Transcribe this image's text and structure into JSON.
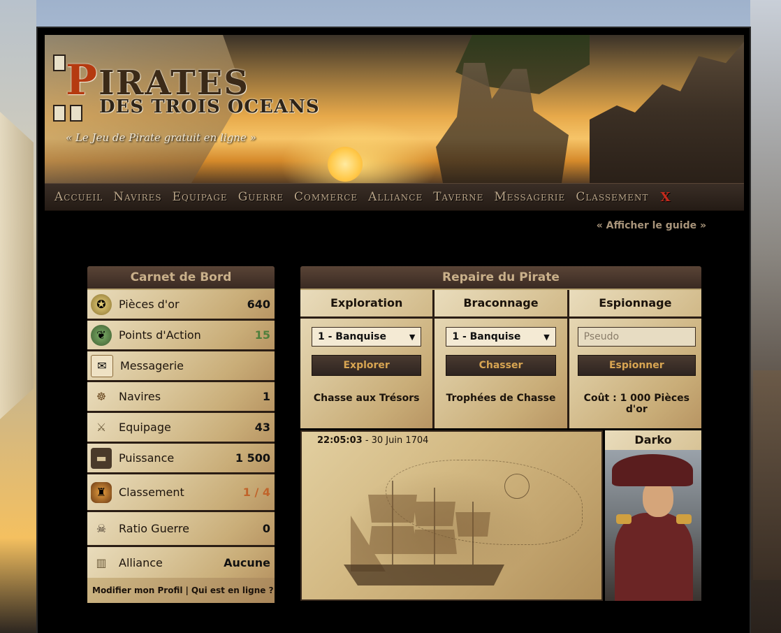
{
  "logo": {
    "line1_cap": "P",
    "line1_rest": "IRATES",
    "line2": "DES TROIS OCEANS",
    "tagline": "« Le Jeu de Pirate gratuit en ligne »"
  },
  "nav": {
    "items": [
      "Accueil",
      "Navires",
      "Equipage",
      "Guerre",
      "Commerce",
      "Alliance",
      "Taverne",
      "Messagerie",
      "Classement"
    ],
    "close": "X"
  },
  "guide_link": "« Afficher le guide »",
  "logbook": {
    "title": "Carnet de Bord",
    "rows": [
      {
        "label": "Pièces d'or",
        "value": "640",
        "icon": "gold-coin-icon"
      },
      {
        "label": "Points d'Action",
        "value": "15",
        "icon": "parrot-icon",
        "value_color": "#4f7f3c"
      },
      {
        "label": "Messagerie",
        "value": "",
        "icon": "envelope-icon"
      },
      {
        "label": "Navires",
        "value": "1",
        "icon": "ship-wheel-icon"
      },
      {
        "label": "Equipage",
        "value": "43",
        "icon": "crossed-swords-icon"
      },
      {
        "label": "Puissance",
        "value": "1 500",
        "icon": "cannon-icon"
      },
      {
        "label": "Classement",
        "value": "1 / 4",
        "icon": "lantern-icon",
        "value_color": "#c0632a"
      },
      {
        "label": "Ratio Guerre",
        "value": "0",
        "icon": "skull-crossbones-icon"
      },
      {
        "label": "Alliance",
        "value": "Aucune",
        "icon": "fortress-icon"
      }
    ],
    "footer_profile": "Modifier mon Profil",
    "footer_sep": "|",
    "footer_online": "Qui est en ligne ?"
  },
  "lair": {
    "title": "Repaire du Pirate",
    "exploration": {
      "title": "Exploration",
      "select": "1 - Banquise",
      "button": "Explorer",
      "link": "Chasse aux Trésors"
    },
    "poaching": {
      "title": "Braconnage",
      "select": "1 - Banquise",
      "button": "Chasser",
      "link": "Trophées de Chasse"
    },
    "espionage": {
      "title": "Espionnage",
      "placeholder": "Pseudo",
      "button": "Espionner",
      "cost": "Coût : 1 000 Pièces d'or"
    },
    "clock_time": "22:05:03",
    "clock_date": "- 30 Juin 1704",
    "captain_name": "Darko"
  }
}
